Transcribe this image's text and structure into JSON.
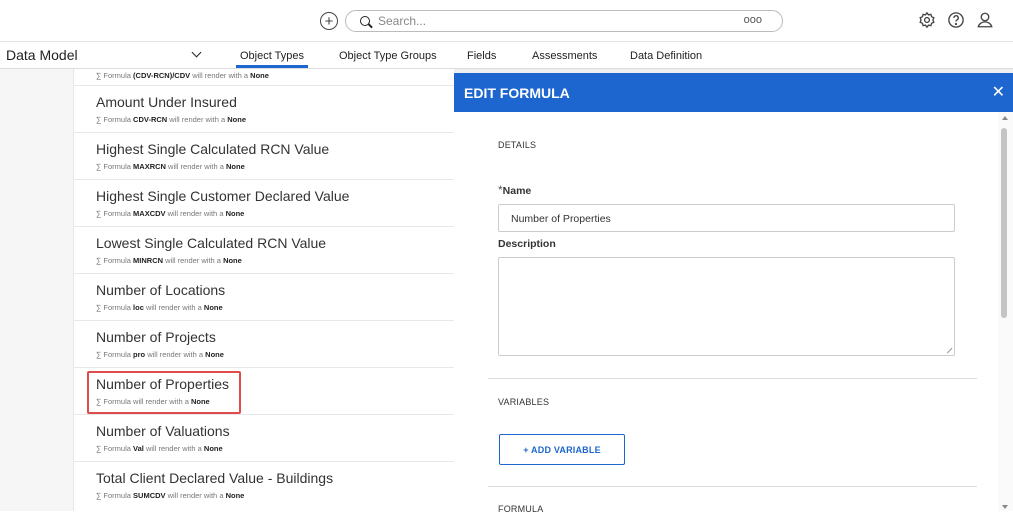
{
  "topbar": {
    "search_placeholder": "Search...",
    "search_more": "ooo"
  },
  "navbar": {
    "title": "Data Model",
    "tabs": [
      {
        "label": "Object Types",
        "active": true
      },
      {
        "label": "Object Type Groups",
        "active": false
      },
      {
        "label": "Fields",
        "active": false
      },
      {
        "label": "Assessments",
        "active": false
      },
      {
        "label": "Data Definition",
        "active": false
      }
    ]
  },
  "list": {
    "first_sub": {
      "prefix": "∑ Formula ",
      "code": "(CDV-RCN)/CDV",
      "mid": " will render with a ",
      "type": "None"
    },
    "items": [
      {
        "title": "Amount Under Insured",
        "prefix": "∑ Formula ",
        "code": "CDV-RCN",
        "mid": " will render with a ",
        "type": "None"
      },
      {
        "title": "Highest Single Calculated RCN Value",
        "prefix": "∑ Formula ",
        "code": "MAXRCN",
        "mid": " will render with a ",
        "type": "None"
      },
      {
        "title": "Highest Single Customer Declared Value",
        "prefix": "∑ Formula ",
        "code": "MAXCDV",
        "mid": " will render with a ",
        "type": "None"
      },
      {
        "title": "Lowest Single Calculated RCN Value",
        "prefix": "∑ Formula ",
        "code": "MINRCN",
        "mid": " will render with a ",
        "type": "None"
      },
      {
        "title": "Number of Locations",
        "prefix": "∑ Formula ",
        "code": "loc",
        "mid": " will render with a ",
        "type": "None"
      },
      {
        "title": "Number of Projects",
        "prefix": "∑ Formula ",
        "code": "pro",
        "mid": " will render with a ",
        "type": "None"
      },
      {
        "title": "Number of Properties",
        "prefix": "∑ Formula",
        "code": "",
        "mid": " will render with a ",
        "type": "None"
      },
      {
        "title": "Number of Valuations",
        "prefix": "∑ Formula ",
        "code": "Val",
        "mid": " will render with a ",
        "type": "None"
      },
      {
        "title": "Total Client Declared Value - Buildings",
        "prefix": "∑ Formula ",
        "code": "SUMCDV",
        "mid": " will render with a ",
        "type": "None"
      }
    ]
  },
  "panel": {
    "title": "EDIT FORMULA",
    "close": "✕",
    "details_label": "DETAILS",
    "name_required": "*",
    "name_label": "Name",
    "name_value": "Number of Properties",
    "description_label": "Description",
    "variables_label": "VARIABLES",
    "add_variable_label": "+ ADD VARIABLE",
    "formula_label": "FORMULA"
  },
  "colors": {
    "accent": "#1d66cf",
    "highlight": "#e04b4b"
  }
}
